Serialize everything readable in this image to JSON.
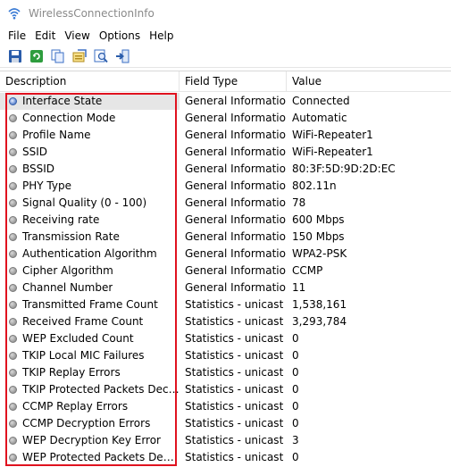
{
  "window": {
    "title": "WirelessConnectionInfo"
  },
  "menu": [
    "File",
    "Edit",
    "View",
    "Options",
    "Help"
  ],
  "toolbar": [
    {
      "icon": "save-icon"
    },
    {
      "icon": "refresh-icon"
    },
    {
      "icon": "copy-icon"
    },
    {
      "icon": "properties-icon"
    },
    {
      "icon": "find-icon"
    },
    {
      "icon": "exit-icon"
    }
  ],
  "columns": {
    "description": "Description",
    "field_type": "Field Type",
    "value": "Value"
  },
  "rows": [
    {
      "description": "Interface State",
      "field_type": "General Information",
      "value": "Connected",
      "icon": "globe-icon"
    },
    {
      "description": "Connection Mode",
      "field_type": "General Information",
      "value": "Automatic",
      "icon": "bullet-icon"
    },
    {
      "description": "Profile Name",
      "field_type": "General Information",
      "value": "WiFi-Repeater1",
      "icon": "bullet-icon"
    },
    {
      "description": "SSID",
      "field_type": "General Information",
      "value": "WiFi-Repeater1",
      "icon": "bullet-icon"
    },
    {
      "description": "BSSID",
      "field_type": "General Information",
      "value": "80:3F:5D:9D:2D:EC",
      "icon": "bullet-icon"
    },
    {
      "description": "PHY Type",
      "field_type": "General Information",
      "value": "802.11n",
      "icon": "bullet-icon"
    },
    {
      "description": "Signal Quality (0 - 100)",
      "field_type": "General Information",
      "value": "78",
      "icon": "bullet-icon"
    },
    {
      "description": "Receiving rate",
      "field_type": "General Information",
      "value": "600 Mbps",
      "icon": "bullet-icon"
    },
    {
      "description": "Transmission Rate",
      "field_type": "General Information",
      "value": "150 Mbps",
      "icon": "bullet-icon"
    },
    {
      "description": "Authentication Algorithm",
      "field_type": "General Information",
      "value": "WPA2-PSK",
      "icon": "bullet-icon"
    },
    {
      "description": "Cipher Algorithm",
      "field_type": "General Information",
      "value": "CCMP",
      "icon": "bullet-icon"
    },
    {
      "description": "Channel Number",
      "field_type": "General Information",
      "value": "11",
      "icon": "bullet-icon"
    },
    {
      "description": "Transmitted Frame Count",
      "field_type": "Statistics - unicast ...",
      "value": "1,538,161",
      "icon": "bullet-icon"
    },
    {
      "description": "Received Frame Count",
      "field_type": "Statistics - unicast ...",
      "value": "3,293,784",
      "icon": "bullet-icon"
    },
    {
      "description": "WEP Excluded Count",
      "field_type": "Statistics - unicast ...",
      "value": "0",
      "icon": "bullet-icon"
    },
    {
      "description": "TKIP Local MIC Failures",
      "field_type": "Statistics - unicast ...",
      "value": "0",
      "icon": "bullet-icon"
    },
    {
      "description": "TKIP Replay Errors",
      "field_type": "Statistics - unicast ...",
      "value": "0",
      "icon": "bullet-icon"
    },
    {
      "description": "TKIP Protected Packets Decrypt...",
      "field_type": "Statistics - unicast ...",
      "value": "0",
      "icon": "bullet-icon"
    },
    {
      "description": "CCMP Replay Errors",
      "field_type": "Statistics - unicast ...",
      "value": "0",
      "icon": "bullet-icon"
    },
    {
      "description": "CCMP Decryption Errors",
      "field_type": "Statistics - unicast ...",
      "value": "0",
      "icon": "bullet-icon"
    },
    {
      "description": "WEP Decryption Key Error",
      "field_type": "Statistics - unicast ...",
      "value": "3",
      "icon": "bullet-icon"
    },
    {
      "description": "WEP Protected Packets Decrypt...",
      "field_type": "Statistics - unicast ...",
      "value": "0",
      "icon": "bullet-icon"
    }
  ],
  "highlight": {
    "color": "#e0121f",
    "covers": "description column"
  }
}
